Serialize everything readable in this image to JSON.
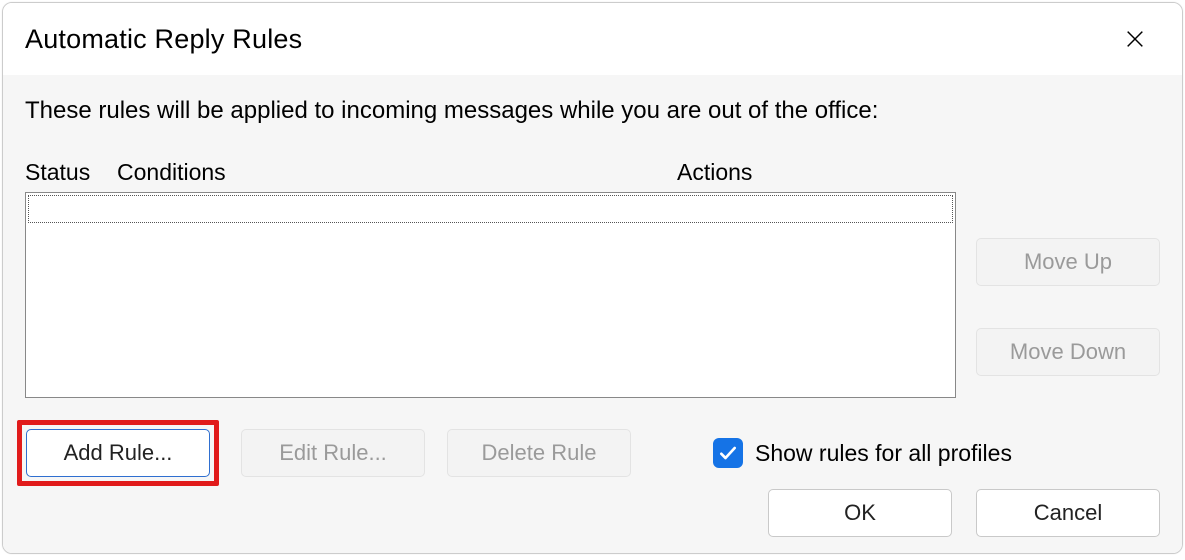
{
  "dialog": {
    "title": "Automatic Reply Rules",
    "description": "These rules will be applied to incoming messages while you are out of the office:",
    "columns": {
      "status": "Status",
      "conditions": "Conditions",
      "actions": "Actions"
    },
    "side": {
      "move_up": "Move Up",
      "move_down": "Move Down"
    },
    "actions": {
      "add_rule": "Add Rule...",
      "edit_rule": "Edit Rule...",
      "delete_rule": "Delete Rule"
    },
    "checkbox": {
      "label": "Show rules for all profiles",
      "checked": true
    },
    "footer": {
      "ok": "OK",
      "cancel": "Cancel"
    }
  }
}
